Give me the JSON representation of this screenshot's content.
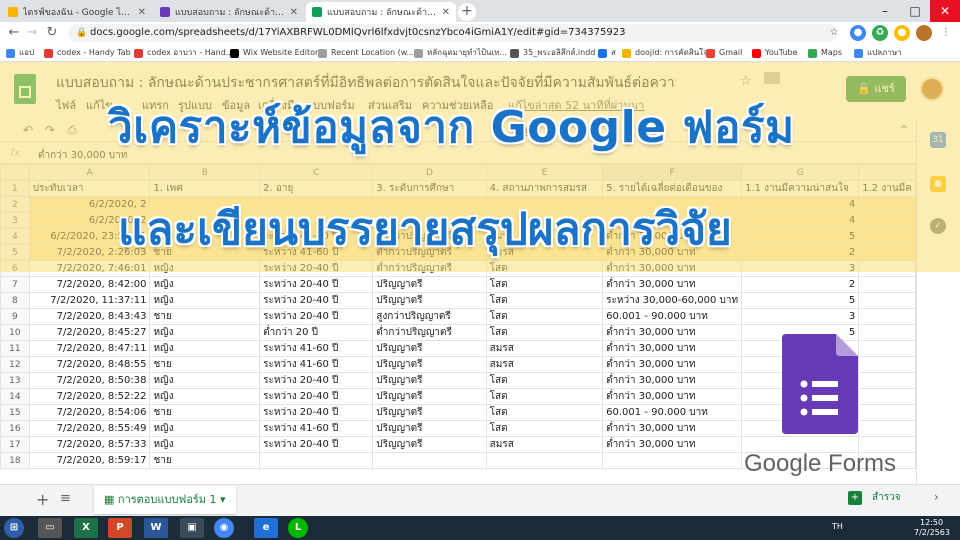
{
  "browser": {
    "tabs": [
      {
        "label": "ไดรฟ์ของฉัน - Google ไดรฟ์",
        "active": false
      },
      {
        "label": "แบบสอบถาม : ลักษณะด้านประชากรศ",
        "active": false
      },
      {
        "label": "แบบสอบถาม : ลักษณะด้านประชากรศ",
        "active": true
      }
    ],
    "url": "docs.google.com/spreadsheets/d/17YiAXBRFWL0DMlQvrl6lfxdvjt0csnzYbco4iGmiA1Y/edit#gid=734375923",
    "bookmarks": [
      "แอป",
      "codex - Handy Tab",
      "codex อาบวา - Hand...",
      "Wix Website Editor",
      "Recent Location (w...",
      "หลักฉุดมายุทำไป้นเท...",
      "35_พระอลิสึกส์.indd",
      "ส",
      "doojid: การคัดสินใจ",
      "Gmail",
      "YouTube",
      "Maps",
      "แปลภาษา"
    ]
  },
  "sheets": {
    "title": "แบบสอบถาม : ลักษณะด้านประชากรศาสตร์ที่มีอิทธิพลต่อการตัดสินใจและปัจจัยที่มีความสัมพันธ์ต่อความสนใจสมัคร...",
    "menu": [
      "ไฟล์",
      "แก้ไข",
      "แทรก",
      "รูปแบบ",
      "ข้อมูล",
      "เครื่องมือ",
      "แบบฟอร์ม",
      "ส่วนเสริม",
      "ความช่วยเหลือ"
    ],
    "last_edit": "แก้ไขล่าสุด 52 นาทีที่ผ่านมา",
    "share_label": "แชร์",
    "formula_value": "ต่ำกว่า 30,000 บาท",
    "columns": [
      "A",
      "B",
      "C",
      "D",
      "E",
      "F",
      "G",
      ""
    ],
    "header_row": [
      "ประทับเวลา",
      "1. เพศ",
      "2. อายุ",
      "3. ระดับการศึกษา",
      "4. สถานภาพการสมรส",
      "5. รายได้เฉลี่ยต่อเดือนของ",
      "1.1 งานมีความน่าสนใจ",
      "1.2 งานมีค"
    ],
    "rows": [
      [
        "6/2/2020, 2",
        "",
        "",
        "",
        "",
        "",
        "4"
      ],
      [
        "6/2/2020, 2",
        "",
        "",
        "",
        "",
        "",
        "4"
      ],
      [
        "6/2/2020, 23:54:21",
        "หญิง",
        "ระหว่าง 41-60 ปี",
        "ต่ำกว่าปริญญาตรี",
        "สมรส",
        "ต่ำกว่า 30,000 บาท",
        "5"
      ],
      [
        "7/2/2020, 2:26:03",
        "ชาย",
        "ระหว่าง 41-60 ปี",
        "ต่ำกว่าปริญญาตรี",
        "สมรส",
        "ต่ำกว่า 30,000 บาท",
        "2"
      ],
      [
        "7/2/2020, 7:46:01",
        "หญิง",
        "ระหว่าง 20-40 ปี",
        "ต่ำกว่าปริญญาตรี",
        "โสด",
        "ต่ำกว่า 30,000 บาท",
        "3"
      ],
      [
        "7/2/2020, 8:42:00",
        "หญิง",
        "ระหว่าง 20-40 ปี",
        "ปริญญาตรี",
        "โสด",
        "ต่ำกว่า 30,000 บาท",
        "2"
      ],
      [
        "7/2/2020, 11:37:11",
        "หญิง",
        "ระหว่าง 20-40 ปี",
        "ปริญญาตรี",
        "โสด",
        "ระหว่าง 30,000-60,000 บาท",
        "5"
      ],
      [
        "7/2/2020, 8:43:43",
        "ชาย",
        "ระหว่าง 20-40 ปี",
        "สูงกว่าปริญญาตรี",
        "โสด",
        "60.001 - 90.000 บาท",
        "3"
      ],
      [
        "7/2/2020, 8:45:27",
        "หญิง",
        "ต่ำกว่า 20 ปี",
        "ต่ำกว่าปริญญาตรี",
        "โสด",
        "ต่ำกว่า 30,000 บาท",
        "5"
      ],
      [
        "7/2/2020, 8:47:11",
        "หญิง",
        "ระหว่าง 41-60 ปี",
        "ปริญญาตรี",
        "สมรส",
        "ต่ำกว่า 30,000 บาท",
        ""
      ],
      [
        "7/2/2020, 8:48:55",
        "ชาย",
        "ระหว่าง 41-60 ปี",
        "ปริญญาตรี",
        "สมรส",
        "ต่ำกว่า 30,000 บาท",
        ""
      ],
      [
        "7/2/2020, 8:50:38",
        "หญิง",
        "ระหว่าง 20-40 ปี",
        "ปริญญาตรี",
        "โสด",
        "ต่ำกว่า 30,000 บาท",
        ""
      ],
      [
        "7/2/2020, 8:52:22",
        "หญิง",
        "ระหว่าง 20-40 ปี",
        "ปริญญาตรี",
        "โสด",
        "ต่ำกว่า 30,000 บาท",
        ""
      ],
      [
        "7/2/2020, 8:54:06",
        "ชาย",
        "ระหว่าง 20-40 ปี",
        "ปริญญาตรี",
        "โสด",
        "60.001 - 90.000 บาท",
        ""
      ],
      [
        "7/2/2020, 8:55:49",
        "หญิง",
        "ระหว่าง 41-60 ปี",
        "ปริญญาตรี",
        "โสด",
        "ต่ำกว่า 30,000 บาท",
        ""
      ],
      [
        "7/2/2020, 8:57:33",
        "หญิง",
        "ระหว่าง 20-40 ปี",
        "ปริญญาตรี",
        "สมรส",
        "ต่ำกว่า 30,000 บาท",
        ""
      ],
      [
        "7/2/2020, 8:59:17",
        "ชาย",
        "",
        "",
        "",
        "",
        ""
      ]
    ],
    "sheet_tab": "การตอบแบบฟอร์ม 1",
    "explore_label": "สำรวจ"
  },
  "overlay": {
    "line1": "วิเคราะห์ข้อมูลจาก Google ฟอร์ม",
    "line2": "และเขียนบรรยายสรุปผลการวิจัย",
    "brand": "Google Forms"
  },
  "taskbar": {
    "lang": "TH",
    "time": "12:50",
    "date": "7/2/2563"
  },
  "colors": {
    "sheets_green": "#0f9d58",
    "share_green": "#1e8e3e",
    "banner_blue": "#1a73c7",
    "forms_purple": "#673ab7"
  }
}
